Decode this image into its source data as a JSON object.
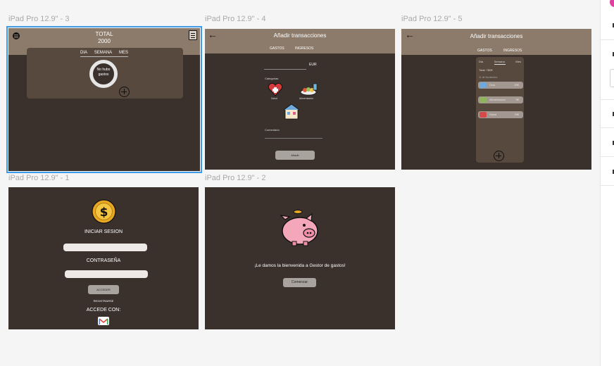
{
  "frames": {
    "f3": {
      "label": "iPad Pro 12.9\" - 3",
      "total_label": "TOTAL",
      "total_value": "2000",
      "tabs": [
        "DIA",
        "SEMANA",
        "MES"
      ],
      "empty_text_1": "No hubo",
      "empty_text_2": "gastos"
    },
    "f4": {
      "label": "iPad Pro 12.9\" - 4",
      "title": "Añadir transacciones",
      "tab_gastos": "GASTOS",
      "tab_ingresos": "INGRESOS",
      "currency": "EUR",
      "categorias_label": "Categorias",
      "cat_salud": "Salud",
      "cat_alimentacion": "Alimentacion",
      "comentario_label": "Comentario",
      "submit_label": "Añadir"
    },
    "f5": {
      "label": "iPad Pro 12.9\" - 5",
      "title": "Añadir transacciones",
      "tab_gastos": "GASTOS",
      "tab_ingresos": "INGRESOS",
      "period_tabs": [
        "Dia",
        "Semana",
        "Mes"
      ],
      "total_line": "Total: 780€",
      "period_line": "11 de Noviembre",
      "rows": [
        {
          "label": "Ocio",
          "value": "25€",
          "color": "#6fa8dc"
        },
        {
          "label": "Alimentacion",
          "value": "5€",
          "color": "#8fb55c"
        },
        {
          "label": "Salud",
          "value": "75€",
          "color": "#d84a4a"
        }
      ]
    },
    "f1": {
      "label": "iPad Pro 12.9\" - 1",
      "login_title": "INICIAR SESION",
      "password_label": "CONTRASEÑA",
      "access_button": "ACCEDER",
      "register_link": "REGISTRARSE",
      "access_with": "ACCEDE CON:"
    },
    "f2": {
      "label": "iPad Pro 12.9\" - 2",
      "welcome": "¡Le damos la bienvenida a Gestor de gastos!",
      "start_button": "Comenzar"
    }
  },
  "colors": {
    "frame_bg": "#3a302c",
    "header": "#8c7b6b",
    "panel": "#58493e",
    "selection": "#3d9be9",
    "coin": "#e9a824",
    "piggy": "#f4a7b9"
  }
}
